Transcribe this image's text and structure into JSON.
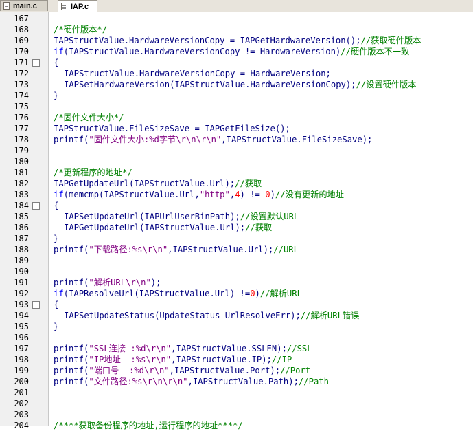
{
  "tabs": [
    {
      "label": "main.c",
      "active": false
    },
    {
      "label": "IAP.c",
      "active": true
    }
  ],
  "colors": {
    "comment": "#008000",
    "keyword": "#0000ff",
    "string": "#800080",
    "number": "#ff0000",
    "identifier": "#000080"
  },
  "lines": [
    {
      "n": "167",
      "fold": "",
      "tokens": []
    },
    {
      "n": "168",
      "fold": "",
      "tokens": [
        {
          "t": "/*硬件版本*/",
          "c": "cmt"
        }
      ]
    },
    {
      "n": "169",
      "fold": "",
      "tokens": [
        {
          "t": "IAPStructValue.HardwareVersionCopy = IAPGetHardwareVersion();",
          "c": "def"
        },
        {
          "t": "//获取硬件版本",
          "c": "cmt"
        }
      ]
    },
    {
      "n": "170",
      "fold": "",
      "tokens": [
        {
          "t": "if",
          "c": "kw"
        },
        {
          "t": "(IAPStructValue.HardwareVersionCopy != HardwareVersion)",
          "c": "def"
        },
        {
          "t": "//硬件版本不一致",
          "c": "cmt"
        }
      ]
    },
    {
      "n": "171",
      "fold": "open",
      "tokens": [
        {
          "t": "{",
          "c": "def"
        }
      ]
    },
    {
      "n": "172",
      "fold": "mid",
      "indent": 1,
      "tokens": [
        {
          "t": "IAPStructValue.HardwareVersionCopy = HardwareVersion;",
          "c": "def"
        }
      ]
    },
    {
      "n": "173",
      "fold": "mid",
      "indent": 1,
      "tokens": [
        {
          "t": "IAPSetHardwareVersion(IAPStructValue.HardwareVersionCopy);",
          "c": "def"
        },
        {
          "t": "//设置硬件版本",
          "c": "cmt"
        }
      ]
    },
    {
      "n": "174",
      "fold": "end",
      "tokens": [
        {
          "t": "}",
          "c": "def"
        }
      ]
    },
    {
      "n": "175",
      "fold": "",
      "tokens": []
    },
    {
      "n": "176",
      "fold": "",
      "tokens": [
        {
          "t": "/*固件文件大小*/",
          "c": "cmt"
        }
      ]
    },
    {
      "n": "177",
      "fold": "",
      "tokens": [
        {
          "t": "IAPStructValue.FileSizeSave = IAPGetFileSize();",
          "c": "def"
        }
      ]
    },
    {
      "n": "178",
      "fold": "",
      "tokens": [
        {
          "t": "printf(",
          "c": "def"
        },
        {
          "t": "\"固件文件大小:%d字节\\r\\n\\r\\n\"",
          "c": "str"
        },
        {
          "t": ",IAPStructValue.FileSizeSave);",
          "c": "def"
        }
      ]
    },
    {
      "n": "179",
      "fold": "",
      "tokens": []
    },
    {
      "n": "180",
      "fold": "",
      "tokens": []
    },
    {
      "n": "181",
      "fold": "",
      "tokens": [
        {
          "t": "/*更新程序的地址*/",
          "c": "cmt"
        }
      ]
    },
    {
      "n": "182",
      "fold": "",
      "tokens": [
        {
          "t": "IAPGetUpdateUrl(IAPStructValue.Url);",
          "c": "def"
        },
        {
          "t": "//获取",
          "c": "cmt"
        }
      ]
    },
    {
      "n": "183",
      "fold": "",
      "tokens": [
        {
          "t": "if",
          "c": "kw"
        },
        {
          "t": "(memcmp(IAPStructValue.Url,",
          "c": "def"
        },
        {
          "t": "\"http\"",
          "c": "str"
        },
        {
          "t": ",",
          "c": "def"
        },
        {
          "t": "4",
          "c": "num"
        },
        {
          "t": ") != ",
          "c": "def"
        },
        {
          "t": "0",
          "c": "num"
        },
        {
          "t": ")",
          "c": "def"
        },
        {
          "t": "//没有更新的地址",
          "c": "cmt"
        }
      ]
    },
    {
      "n": "184",
      "fold": "open",
      "tokens": [
        {
          "t": "{",
          "c": "def"
        }
      ]
    },
    {
      "n": "185",
      "fold": "mid",
      "indent": 1,
      "tokens": [
        {
          "t": "IAPSetUpdateUrl(IAPUrlUserBinPath);",
          "c": "def"
        },
        {
          "t": "//设置默认URL",
          "c": "cmt"
        }
      ]
    },
    {
      "n": "186",
      "fold": "mid",
      "indent": 1,
      "tokens": [
        {
          "t": "IAPGetUpdateUrl(IAPStructValue.Url);",
          "c": "def"
        },
        {
          "t": "//获取",
          "c": "cmt"
        }
      ]
    },
    {
      "n": "187",
      "fold": "end",
      "tokens": [
        {
          "t": "}",
          "c": "def"
        }
      ]
    },
    {
      "n": "188",
      "fold": "",
      "tokens": [
        {
          "t": "printf(",
          "c": "def"
        },
        {
          "t": "\"下载路径:%s\\r\\n\"",
          "c": "str"
        },
        {
          "t": ",IAPStructValue.Url);",
          "c": "def"
        },
        {
          "t": "//URL",
          "c": "cmt"
        }
      ]
    },
    {
      "n": "189",
      "fold": "",
      "tokens": []
    },
    {
      "n": "190",
      "fold": "",
      "tokens": []
    },
    {
      "n": "191",
      "fold": "",
      "tokens": [
        {
          "t": "printf(",
          "c": "def"
        },
        {
          "t": "\"解析URL\\r\\n\"",
          "c": "str"
        },
        {
          "t": ");",
          "c": "def"
        }
      ]
    },
    {
      "n": "192",
      "fold": "",
      "tokens": [
        {
          "t": "if",
          "c": "kw"
        },
        {
          "t": "(IAPResolveUrl(IAPStructValue.Url) !=",
          "c": "def"
        },
        {
          "t": "0",
          "c": "num"
        },
        {
          "t": ")",
          "c": "def"
        },
        {
          "t": "//解析URL",
          "c": "cmt"
        }
      ]
    },
    {
      "n": "193",
      "fold": "open",
      "tokens": [
        {
          "t": "{",
          "c": "def"
        }
      ]
    },
    {
      "n": "194",
      "fold": "mid",
      "indent": 1,
      "tokens": [
        {
          "t": "IAPSetUpdateStatus(UpdateStatus_UrlResolveErr);",
          "c": "def"
        },
        {
          "t": "//解析URL错误",
          "c": "cmt"
        }
      ]
    },
    {
      "n": "195",
      "fold": "end",
      "tokens": [
        {
          "t": "}",
          "c": "def"
        }
      ]
    },
    {
      "n": "196",
      "fold": "",
      "tokens": []
    },
    {
      "n": "197",
      "fold": "",
      "tokens": [
        {
          "t": "printf(",
          "c": "def"
        },
        {
          "t": "\"SSL连接 :%d\\r\\n\"",
          "c": "str"
        },
        {
          "t": ",IAPStructValue.SSLEN);",
          "c": "def"
        },
        {
          "t": "//SSL",
          "c": "cmt"
        }
      ]
    },
    {
      "n": "198",
      "fold": "",
      "tokens": [
        {
          "t": "printf(",
          "c": "def"
        },
        {
          "t": "\"IP地址  :%s\\r\\n\"",
          "c": "str"
        },
        {
          "t": ",IAPStructValue.IP);",
          "c": "def"
        },
        {
          "t": "//IP",
          "c": "cmt"
        }
      ]
    },
    {
      "n": "199",
      "fold": "",
      "tokens": [
        {
          "t": "printf(",
          "c": "def"
        },
        {
          "t": "\"端口号  :%d\\r\\n\"",
          "c": "str"
        },
        {
          "t": ",IAPStructValue.Port);",
          "c": "def"
        },
        {
          "t": "//Port",
          "c": "cmt"
        }
      ]
    },
    {
      "n": "200",
      "fold": "",
      "tokens": [
        {
          "t": "printf(",
          "c": "def"
        },
        {
          "t": "\"文件路径:%s\\r\\n\\r\\n\"",
          "c": "str"
        },
        {
          "t": ",IAPStructValue.Path);",
          "c": "def"
        },
        {
          "t": "//Path",
          "c": "cmt"
        }
      ]
    },
    {
      "n": "201",
      "fold": "",
      "tokens": []
    },
    {
      "n": "202",
      "fold": "",
      "tokens": []
    },
    {
      "n": "203",
      "fold": "",
      "tokens": []
    },
    {
      "n": "204",
      "fold": "",
      "tokens": [
        {
          "t": "/****获取备份程序的地址,运行程序的地址****/",
          "c": "cmt"
        }
      ]
    }
  ]
}
